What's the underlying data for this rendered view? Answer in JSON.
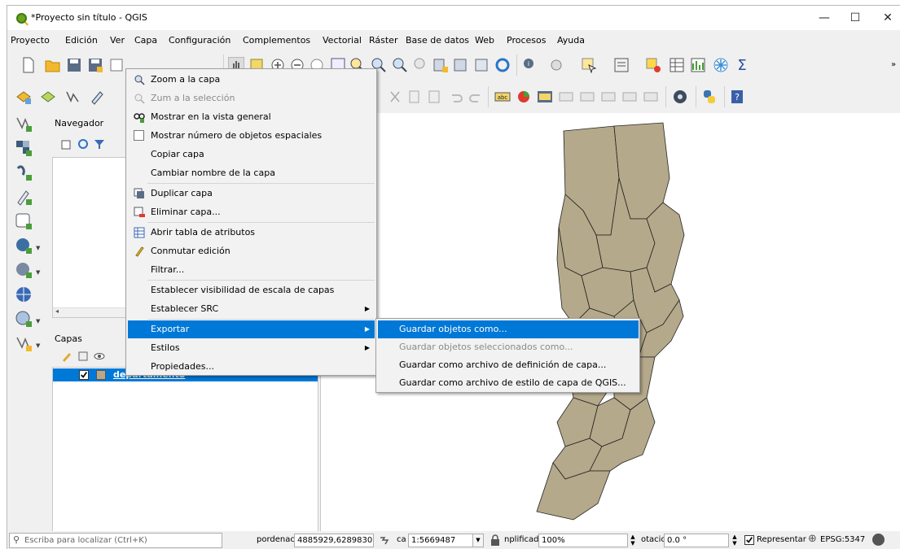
{
  "window": {
    "title": "*Proyecto sin título - QGIS"
  },
  "menubar": [
    "Proyecto",
    "Edición",
    "Ver",
    "Capa",
    "Configuración",
    "Complementos",
    "Vectorial",
    "Ráster",
    "Base de datos",
    "Web",
    "Procesos",
    "Ayuda"
  ],
  "navigator": {
    "title": "Navegador"
  },
  "layers": {
    "title": "Capas",
    "layer_name": "departamento"
  },
  "context_menu": {
    "items": [
      "Zoom a la capa",
      "Zum a la selección",
      "Mostrar en la vista general",
      "Mostrar número de objetos espaciales",
      "Copiar capa",
      "Cambiar nombre de la capa",
      "Duplicar capa",
      "Eliminar capa...",
      "Abrir tabla de atributos",
      "Conmutar edición",
      "Filtrar...",
      "Establecer visibilidad de escala de capas",
      "Establecer SRC",
      "Exportar",
      "Estilos",
      "Propiedades..."
    ]
  },
  "export_submenu": {
    "items": [
      "Guardar objetos como...",
      "Guardar objetos seleccionados como...",
      "Guardar como archivo de definición de capa...",
      "Guardar como archivo de estilo de capa de QGIS..."
    ]
  },
  "statusbar": {
    "locator_placeholder": "Escriba para localizar (Ctrl+K)",
    "coord_label": "pordenac",
    "coordinate": "4885929,6289830",
    "scale_label": "ca",
    "scale": "1:5669487",
    "magnifier_label": "nplificad",
    "magnifier": "100%",
    "rotation_label": "otacio",
    "rotation": "0.0 °",
    "render_label": "Representar",
    "crs": "EPSG:5347"
  },
  "colors": {
    "accent": "#0078d7",
    "polygon_fill": "#b5a98b",
    "polygon_stroke": "#222222"
  }
}
